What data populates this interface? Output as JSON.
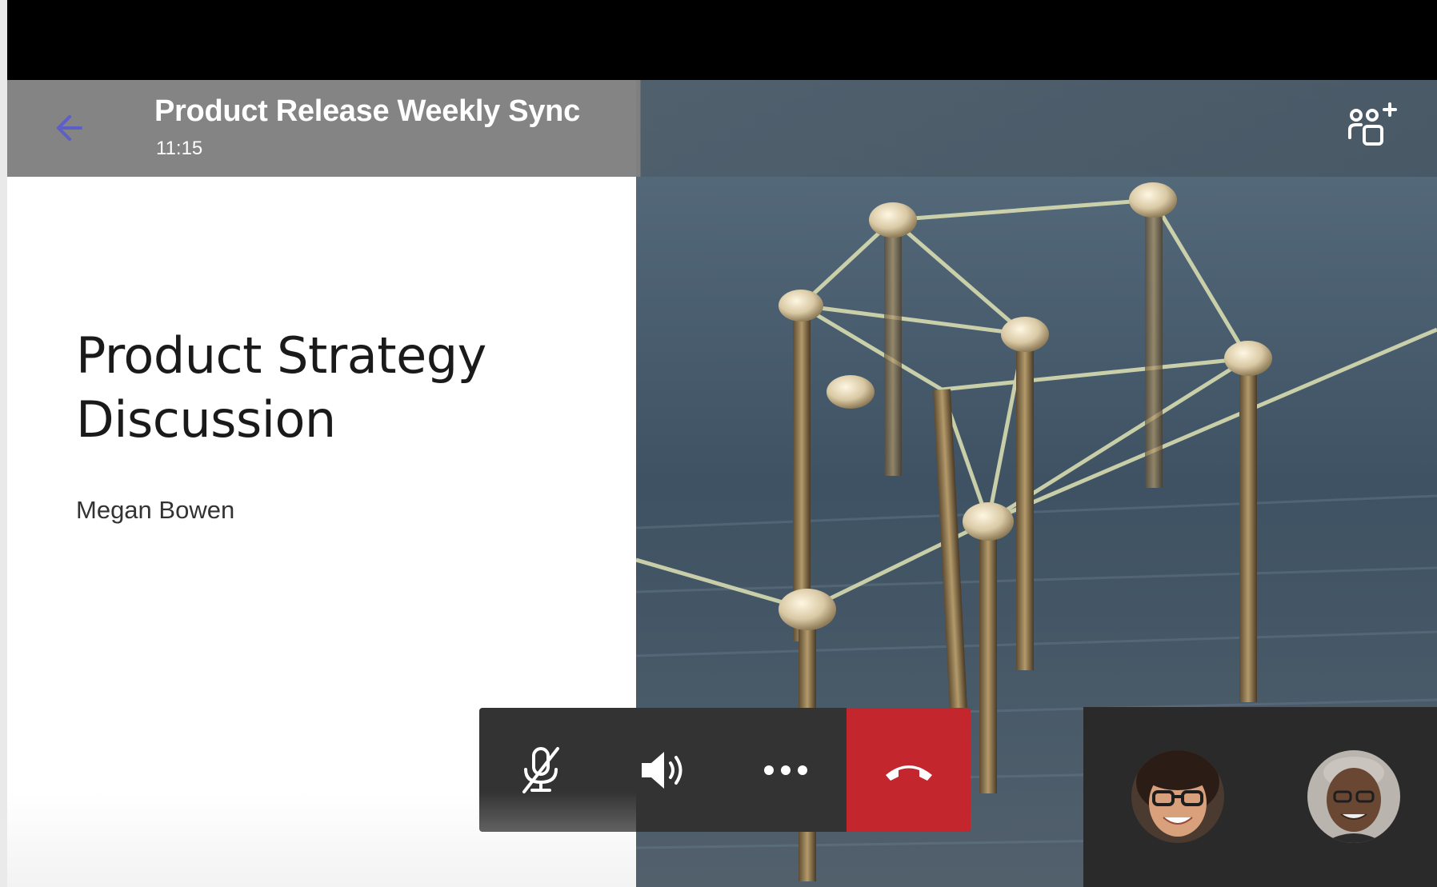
{
  "meeting": {
    "title": "Product Release Weekly Sync",
    "time": "11:15"
  },
  "slide": {
    "title_line1": "Product Strategy",
    "title_line2": "Discussion",
    "presenter": "Megan Bowen"
  },
  "header_icons": {
    "back": "arrow-left-icon",
    "add_people": "add-people-icon"
  },
  "controls": [
    {
      "name": "mute",
      "icon": "microphone-off-icon"
    },
    {
      "name": "speaker",
      "icon": "speaker-icon"
    },
    {
      "name": "more",
      "icon": "more-options-icon"
    },
    {
      "name": "hang_up",
      "icon": "hang-up-icon"
    }
  ],
  "participants": [
    {
      "name": "participant-1",
      "icon": "avatar"
    },
    {
      "name": "participant-2",
      "icon": "avatar"
    }
  ],
  "colors": {
    "hangup": "#c4262e",
    "control_bar": "#333333",
    "header_left": "#808080",
    "back_arrow": "#5b5fc7"
  }
}
